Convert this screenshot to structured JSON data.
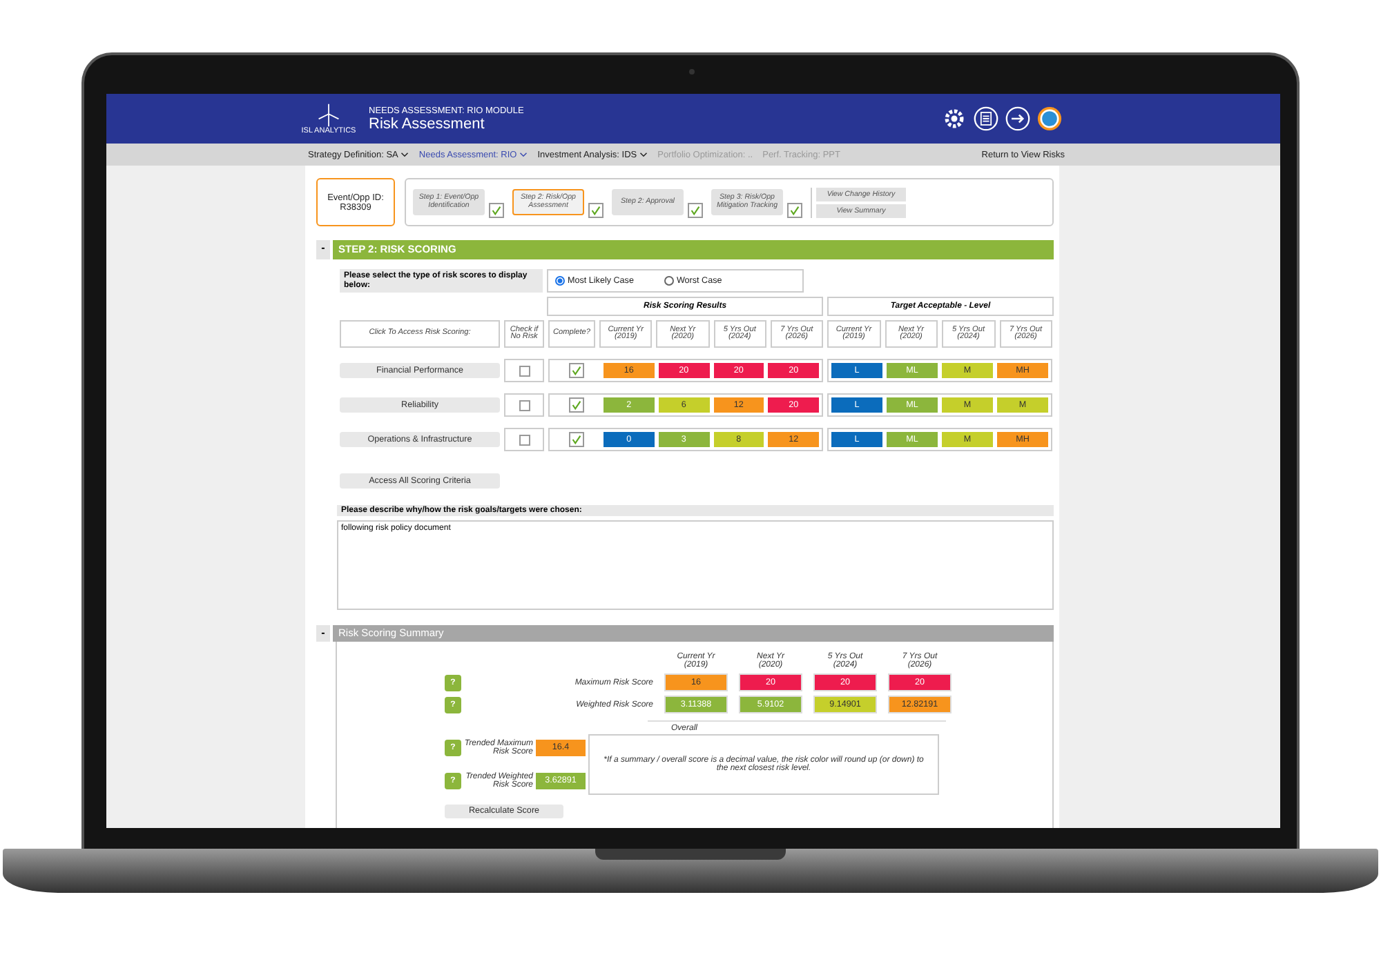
{
  "header": {
    "logo_text": "ISL ANALYTICS",
    "module": "NEEDS ASSESSMENT: RIO MODULE",
    "title": "Risk Assessment"
  },
  "nav": [
    {
      "label": "Strategy Definition: SA",
      "selected": false,
      "disabled": false,
      "has_menu": true
    },
    {
      "label": "Needs Assessment: RIO",
      "selected": true,
      "disabled": false,
      "has_menu": true
    },
    {
      "label": "Investment Analysis: IDS",
      "selected": false,
      "disabled": false,
      "has_menu": true
    },
    {
      "label": "Portfolio Optimization: ..",
      "selected": false,
      "disabled": true,
      "has_menu": false
    },
    {
      "label": "Perf. Tracking: PPT",
      "selected": false,
      "disabled": true,
      "has_menu": false
    }
  ],
  "nav_link": "Return to View Risks",
  "event": {
    "label": "Event/Opp ID:",
    "id": "R38309"
  },
  "steps": [
    {
      "label": "Step 1: Event/Opp Identification",
      "selected": false,
      "checked": true
    },
    {
      "label": "Step 2: Risk/Opp Assessment",
      "selected": true,
      "checked": true
    },
    {
      "label": "Step 2: Approval",
      "selected": false,
      "checked": true
    },
    {
      "label": "Step 3: Risk/Opp Mitigation Tracking",
      "selected": false,
      "checked": true
    }
  ],
  "step_actions": [
    "View Change History",
    "View Summary"
  ],
  "scoring_section": {
    "toggle": "-",
    "title": "STEP 2: RISK SCORING"
  },
  "score_type": {
    "prompt": "Please select the type of risk scores to display below:",
    "options": [
      {
        "label": "Most Likely Case",
        "selected": true
      },
      {
        "label": "Worst Case",
        "selected": false
      }
    ]
  },
  "table": {
    "group_headers": [
      "Risk Scoring Results",
      "Target Acceptable - Level"
    ],
    "row_header": "Click To Access Risk Scoring:",
    "no_risk_header": "Check if No Risk",
    "complete_header": "Complete?",
    "result_years": [
      {
        "label": "Current Yr",
        "year": "(2019)"
      },
      {
        "label": "Next Yr",
        "year": "(2020)"
      },
      {
        "label": "5 Yrs Out",
        "year": "(2024)"
      },
      {
        "label": "7 Yrs Out",
        "year": "(2026)"
      }
    ],
    "target_years": [
      {
        "label": "Current Yr",
        "year": "(2019)"
      },
      {
        "label": "Next Yr",
        "year": "(2020)"
      },
      {
        "label": "5 Yrs Out",
        "year": "(2024)"
      },
      {
        "label": "7 Yrs Out",
        "year": "(2026)"
      }
    ],
    "rows": [
      {
        "name": "Financial Performance",
        "no_risk": false,
        "complete": true,
        "results": [
          {
            "value": "16",
            "color": "#f7941d"
          },
          {
            "value": "20",
            "color": "#ee1c4e"
          },
          {
            "value": "20",
            "color": "#ee1c4e"
          },
          {
            "value": "20",
            "color": "#ee1c4e"
          }
        ],
        "targets": [
          {
            "value": "L",
            "color": "#0b6cbc"
          },
          {
            "value": "ML",
            "color": "#8cb63c"
          },
          {
            "value": "M",
            "color": "#c5cf2b"
          },
          {
            "value": "MH",
            "color": "#f7941d"
          }
        ]
      },
      {
        "name": "Reliability",
        "no_risk": false,
        "complete": true,
        "results": [
          {
            "value": "2",
            "color": "#8cb63c"
          },
          {
            "value": "6",
            "color": "#c5cf2b"
          },
          {
            "value": "12",
            "color": "#f7941d"
          },
          {
            "value": "20",
            "color": "#ee1c4e"
          }
        ],
        "targets": [
          {
            "value": "L",
            "color": "#0b6cbc"
          },
          {
            "value": "ML",
            "color": "#8cb63c"
          },
          {
            "value": "M",
            "color": "#c5cf2b"
          },
          {
            "value": "M",
            "color": "#c5cf2b"
          }
        ]
      },
      {
        "name": "Operations & Infrastructure",
        "no_risk": false,
        "complete": true,
        "results": [
          {
            "value": "0",
            "color": "#0b6cbc"
          },
          {
            "value": "3",
            "color": "#8cb63c"
          },
          {
            "value": "8",
            "color": "#c5cf2b"
          },
          {
            "value": "12",
            "color": "#f7941d"
          }
        ],
        "targets": [
          {
            "value": "L",
            "color": "#0b6cbc"
          },
          {
            "value": "ML",
            "color": "#8cb63c"
          },
          {
            "value": "M",
            "color": "#c5cf2b"
          },
          {
            "value": "MH",
            "color": "#f7941d"
          }
        ]
      }
    ]
  },
  "access_button": "Access All Scoring Criteria",
  "describe": {
    "label": "Please describe why/how the risk goals/targets were chosen:",
    "value": "following risk policy document"
  },
  "summary_section": {
    "toggle": "-",
    "title": "Risk Scoring Summary"
  },
  "summary": {
    "years": [
      {
        "label": "Current Yr",
        "year": "(2019)"
      },
      {
        "label": "Next Yr",
        "year": "(2020)"
      },
      {
        "label": "5 Yrs Out",
        "year": "(2024)"
      },
      {
        "label": "7 Yrs Out",
        "year": "(2026)"
      }
    ],
    "rows": [
      {
        "help": "?",
        "label": "Maximum Risk Score",
        "cells": [
          {
            "value": "16",
            "color": "#f7941d"
          },
          {
            "value": "20",
            "color": "#ee1c4e"
          },
          {
            "value": "20",
            "color": "#ee1c4e"
          },
          {
            "value": "20",
            "color": "#ee1c4e"
          }
        ]
      },
      {
        "help": "?",
        "label": "Weighted Risk Score",
        "cells": [
          {
            "value": "3.11388",
            "color": "#8cb63c"
          },
          {
            "value": "5.9102",
            "color": "#8cb63c"
          },
          {
            "value": "9.14901",
            "color": "#c5cf2b"
          },
          {
            "value": "12.82191",
            "color": "#f7941d"
          }
        ]
      }
    ],
    "overall_label": "Overall",
    "trended": [
      {
        "help": "?",
        "label": "Trended Maximum Risk Score",
        "value": "16.4",
        "color": "#f7941d"
      },
      {
        "help": "?",
        "label": "Trended Weighted Risk Score",
        "value": "3.62891",
        "color": "#8cb63c"
      }
    ],
    "note": "*If a summary / overall score is a decimal value, the risk color will round up (or down) to the next closest risk level.",
    "recalculate": "Recalculate Score"
  }
}
